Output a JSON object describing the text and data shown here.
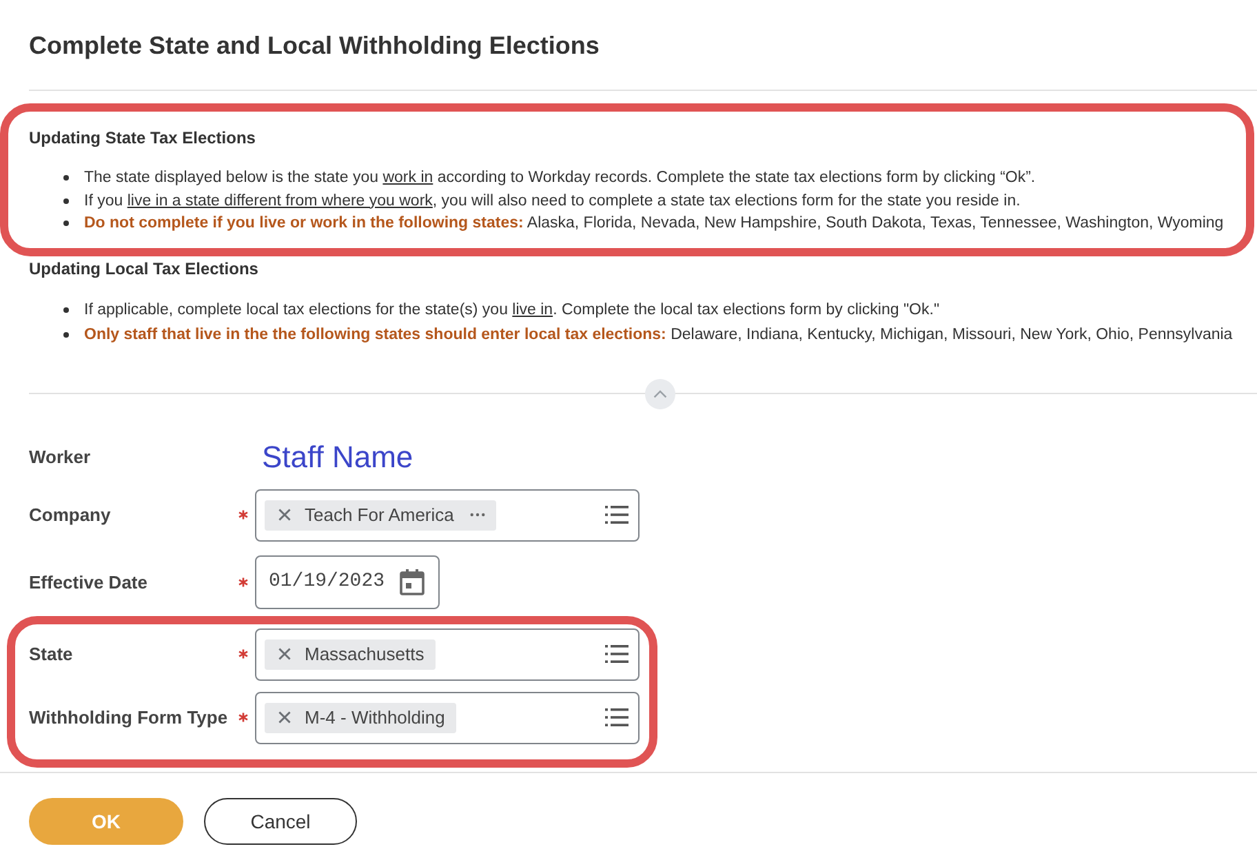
{
  "title": "Complete State and Local Withholding Elections",
  "sections": [
    {
      "heading": "Updating State Tax Elections",
      "highlighted": true,
      "bullets": [
        [
          {
            "kind": "text",
            "text": "The state displayed below is the state you "
          },
          {
            "kind": "underline",
            "text": "work in"
          },
          {
            "kind": "text",
            "text": " according to Workday records. Complete the state tax elections form by clicking “Ok”."
          }
        ],
        [
          {
            "kind": "text",
            "text": "If you "
          },
          {
            "kind": "underline",
            "text": "live in a state different from where you work"
          },
          {
            "kind": "text",
            "text": ", you will also need to complete a state tax elections form for the state you reside in."
          }
        ],
        [
          {
            "kind": "warning",
            "text": "Do not complete if you live or work in the following states:"
          },
          {
            "kind": "text",
            "text": " Alaska, Florida, Nevada, New Hampshire, South Dakota, Texas, Tennessee, Washington, Wyoming"
          }
        ]
      ]
    },
    {
      "heading": "Updating Local Tax Elections",
      "highlighted": false,
      "bullets": [
        [
          {
            "kind": "text",
            "text": "If applicable, complete local tax elections for the state(s) you "
          },
          {
            "kind": "underline",
            "text": "live in"
          },
          {
            "kind": "text",
            "text": ". Complete the local tax elections form by clicking \"Ok.\""
          }
        ],
        [
          {
            "kind": "warning",
            "text": "Only staff that live in the the following states should enter local tax elections:"
          },
          {
            "kind": "text",
            "text": " Delaware, Indiana, Kentucky, Michigan, Missouri, New York, Ohio, Pennsylvania"
          }
        ]
      ]
    }
  ],
  "form": {
    "fields": [
      {
        "label": "Worker",
        "kind": "text",
        "required": false,
        "highlighted": false,
        "value": "Staff Name"
      },
      {
        "label": "Company",
        "kind": "prompt",
        "required": true,
        "highlighted": false,
        "value": "Teach For America",
        "more_actions": true
      },
      {
        "label": "Effective Date",
        "kind": "date",
        "required": true,
        "highlighted": false,
        "value": "01/19/2023"
      },
      {
        "label": "State",
        "kind": "prompt",
        "required": true,
        "highlighted": true,
        "value": "Massachusetts",
        "more_actions": false
      },
      {
        "label": "Withholding Form Type",
        "kind": "prompt",
        "required": true,
        "highlighted": true,
        "value": "M-4 - Withholding",
        "more_actions": false
      }
    ]
  },
  "buttons": [
    {
      "label": "OK",
      "kind": "primary"
    },
    {
      "label": "Cancel",
      "kind": "secondary"
    }
  ]
}
